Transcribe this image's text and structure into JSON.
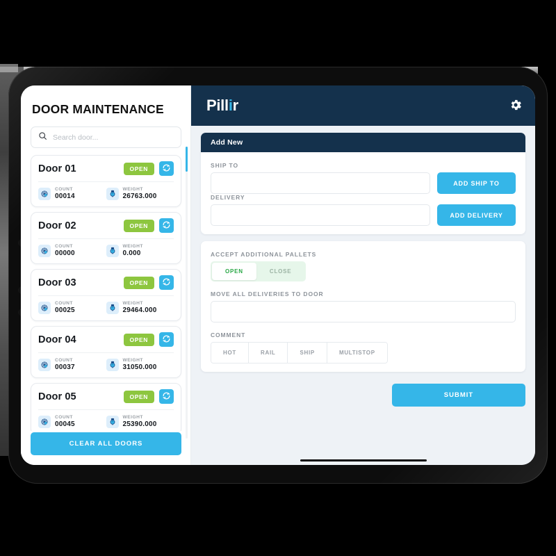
{
  "sidebar": {
    "title": "DOOR MAINTENANCE",
    "search": {
      "placeholder": "Search door...",
      "value": "",
      "icon": "search-icon"
    },
    "metric_labels": {
      "count": "COUNT",
      "weight": "WEIGHT"
    },
    "status_label": "OPEN",
    "refresh_icon": "refresh-icon",
    "doors": [
      {
        "name": "Door 01",
        "status": "OPEN",
        "count": "00014",
        "weight": "26763.000"
      },
      {
        "name": "Door 02",
        "status": "OPEN",
        "count": "00000",
        "weight": "0.000"
      },
      {
        "name": "Door 03",
        "status": "OPEN",
        "count": "00025",
        "weight": "29464.000"
      },
      {
        "name": "Door 04",
        "status": "OPEN",
        "count": "00037",
        "weight": "31050.000"
      },
      {
        "name": "Door 05",
        "status": "OPEN",
        "count": "00045",
        "weight": "25390.000"
      }
    ],
    "clear_all_label": "CLEAR ALL DOORS"
  },
  "topbar": {
    "logo_text": "Pill",
    "logo_highlight": "i",
    "logo_tail": "r",
    "settings_icon": "gear-icon"
  },
  "add_new_card": {
    "header": "Add New",
    "ship_to": {
      "label": "SHIP TO",
      "value": "",
      "placeholder": "",
      "button": "ADD SHIP TO"
    },
    "delivery": {
      "label": "DELIVERY",
      "value": "",
      "placeholder": "",
      "button": "ADD DELIVERY"
    }
  },
  "options_card": {
    "pallets_label": "ACCEPT ADDITIONAL PALLETS",
    "toggle": {
      "options": [
        "OPEN",
        "CLOSE"
      ],
      "selected": "OPEN"
    },
    "move_label": "MOVE ALL DELIVERIES TO DOOR",
    "move_value": "",
    "comment_label": "COMMENT",
    "comment_chips": [
      "HOT",
      "RAIL",
      "SHIP",
      "MULTISTOP"
    ]
  },
  "footer": {
    "submit_label": "SUBMIT"
  },
  "colors": {
    "accent_blue": "#35b6e8",
    "navy": "#14314c",
    "green": "#8dc63f",
    "toggle_green": "#28a745",
    "page_bg": "#eef2f6"
  }
}
